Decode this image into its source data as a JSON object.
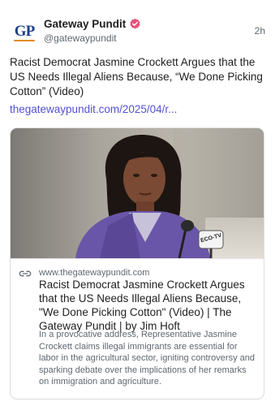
{
  "post": {
    "author": {
      "display_name": "Gateway Pundit",
      "handle": "@gatewaypundit",
      "avatar_text": "GP",
      "verified_icon": "verified-badge-icon",
      "verified_color": "#e8507a"
    },
    "timestamp": "2h",
    "text": "Racist Democrat Jasmine Crockett Argues that the US Needs Illegal Aliens Because, “We Done Picking Cotton” (Video)",
    "link_text": "thegatewaypundit.com/2025/04/r...",
    "link_color": "#5451d6"
  },
  "card": {
    "image_overlay_text": "ECO-TV",
    "link_icon": "link-icon",
    "domain": "www.thegatewaypundit.com",
    "title": "Racist Democrat Jasmine Crockett Argues that the US Needs Illegal Aliens Because, \"We Done Picking Cotton\" (Video) | The Gateway Pundit | by Jim Hoft",
    "description": "In a provocative address, Representative Jasmine Crockett claims illegal immigrants are essential for labor in the agricultural sector, igniting controversy and sparking debate over the implications of her remarks on immigration and agriculture."
  }
}
